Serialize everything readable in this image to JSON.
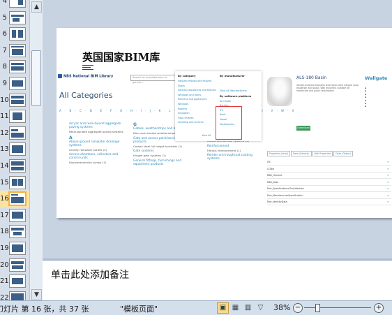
{
  "thumbnails": [
    {
      "num": "4"
    },
    {
      "num": "5"
    },
    {
      "num": "6"
    },
    {
      "num": "7"
    },
    {
      "num": "8"
    },
    {
      "num": "9"
    },
    {
      "num": "10"
    },
    {
      "num": "11"
    },
    {
      "num": "12"
    },
    {
      "num": "13"
    },
    {
      "num": "14"
    },
    {
      "num": "15"
    },
    {
      "num": "16"
    },
    {
      "num": "17"
    },
    {
      "num": "18"
    },
    {
      "num": "19"
    },
    {
      "num": "20"
    },
    {
      "num": "21"
    },
    {
      "num": "22"
    }
  ],
  "active_slide": "16",
  "slide": {
    "title": "英国国家BIM库"
  },
  "web": {
    "logo": "NBS National BIM Library",
    "search_placeholder": "Search for manufacturers or generic...",
    "heading": "All Categories",
    "alphabet": "A · B · C · D · E · F · G · H · I · J · K · L · M · N · O · P · Q · R · S · T · U · V · W · X",
    "col1": [
      {
        "h": "Acrylic and resin-bound aggregate paving systems",
        "s": "Resin-bonded aggregate paving systems"
      },
      {
        "big": "A",
        "h": "Above ground rainwater drainage systems",
        "s": "Gravity rainwater outlets (4)"
      },
      {
        "h": "Access chambers, collectors and control units",
        "s": "Daylowresolution sumps (1)"
      }
    ],
    "col2": [
      {
        "big": "G",
        "h": "Gables, weatherstrips and baffles",
        "s": "Door and window weatherstrips"
      },
      {
        "h": "Gate and access point barrier products",
        "s": "Carbon steel full height turnstiles (1)"
      },
      {
        "h": "Gate systems",
        "s": "Hinged gate systems (1)"
      },
      {
        "h": "General fittings, furnishings and equipment products",
        "s": ""
      }
    ],
    "col3": [
      {
        "h": "Rainscreen cladding systems",
        "s": "Drained and back-ventilated rainscreen cladding systems (2)"
      },
      {
        "h": "Raised access floor systems",
        "s": "Raised access floor systems (4)"
      },
      {
        "h": "Reinforcement",
        "s": "Fibrous reinforcement (1)"
      },
      {
        "h": "Render and roughcast coating systems",
        "s": ""
      }
    ],
    "dropdown": {
      "by_category": "By category",
      "by_manufacturer": "By manufacturer",
      "by_platform": "By software platform",
      "categories": [
        "Sanitary fittings and fixtures",
        "Doors",
        "Sanitary appliances and fixtures",
        "Windows and doors",
        "Kitchens and appliances",
        "Windows",
        "Roofing",
        "Insulation",
        "Floor finishes",
        "Cladding and screens"
      ],
      "platforms": [
        "ArchiCAD",
        "Bentley",
        "IFC",
        "Revit",
        "Vasari",
        "Vectorworks"
      ],
      "view_all": "View All",
      "view_all_manufacturers": "View All Manufacturers"
    },
    "product": {
      "title": "ALS-180 Basin",
      "desc": "Vandal-resistant stainless steel basin with integral soap dispenser and spout. Wall mounted, suitable for healthcare and public washrooms.",
      "brand": "Wallgate",
      "button": "Download",
      "tabs": [
        "Properties (local)",
        "Data (Generic)",
        "Wall Properties",
        "Data (Object)"
      ],
      "rows": [
        "IFC",
        "COBie",
        "NBS_General",
        "NBS_Data",
        "Part_SpecificationsClassification",
        "Part_ManufacturerSpecification",
        "Part_IdentityData"
      ]
    }
  },
  "notes": {
    "placeholder": "单击此处添加备注"
  },
  "status": {
    "slide_info": "幻灯片 第 16 张，共 37 张",
    "theme": "\"模板页面\"",
    "zoom": "38%"
  }
}
